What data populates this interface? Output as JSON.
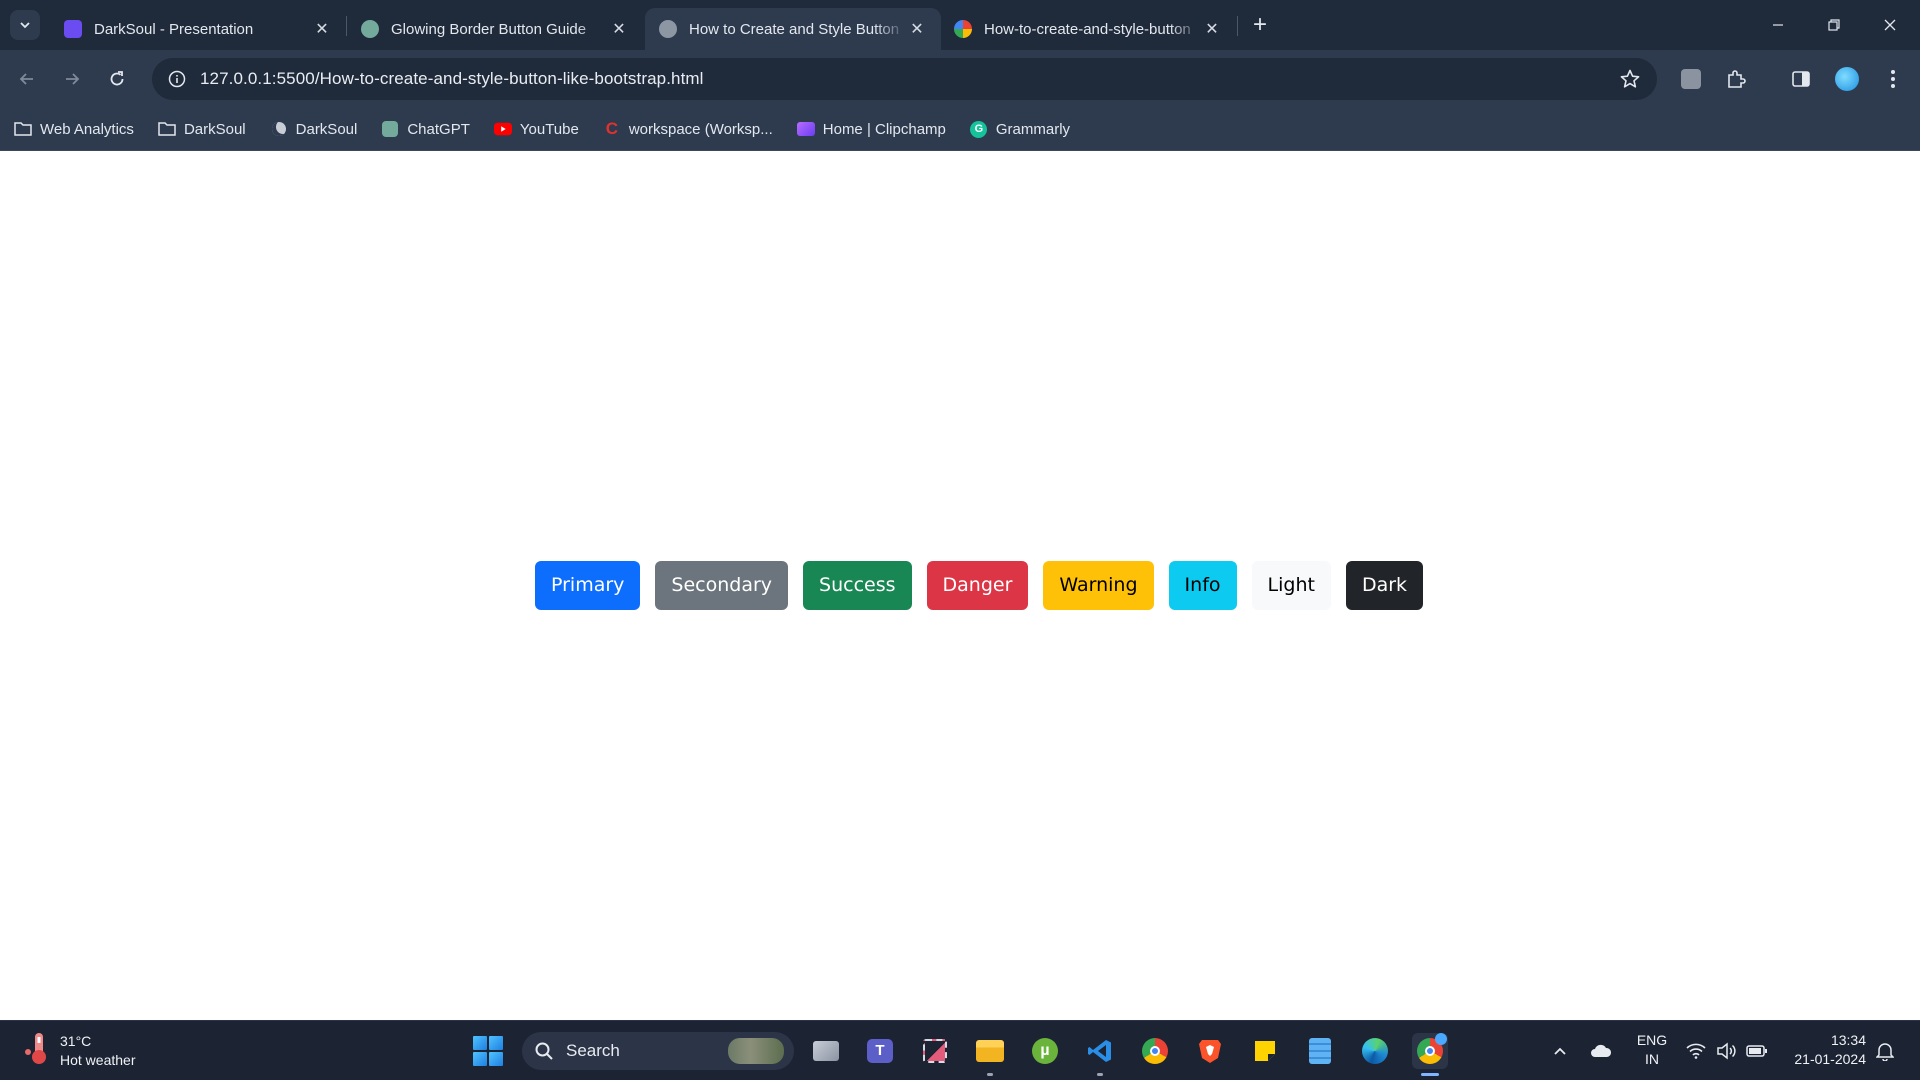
{
  "tabs": [
    {
      "title": "DarkSoul - Presentation",
      "active": false
    },
    {
      "title": "Glowing Border Button Guide",
      "active": false
    },
    {
      "title": "How to Create and Style Button",
      "active": true
    },
    {
      "title": "How-to-create-and-style-button",
      "active": false
    }
  ],
  "new_tab_label": "+",
  "address_bar": {
    "url": "127.0.0.1:5500/How-to-create-and-style-button-like-bootstrap.html"
  },
  "bookmarks": [
    {
      "label": "Web Analytics",
      "icon": "folder-icon"
    },
    {
      "label": "DarkSoul",
      "icon": "folder-icon"
    },
    {
      "label": "DarkSoul",
      "icon": "darksoul-favicon"
    },
    {
      "label": "ChatGPT",
      "icon": "chatgpt-favicon"
    },
    {
      "label": "YouTube",
      "icon": "youtube-favicon"
    },
    {
      "label": "workspace (Worksp...",
      "icon": "codepen-favicon"
    },
    {
      "label": "Home | Clipchamp",
      "icon": "clipchamp-favicon"
    },
    {
      "label": "Grammarly",
      "icon": "grammarly-favicon"
    }
  ],
  "page": {
    "buttons": [
      {
        "label": "Primary",
        "bg": "#0d6efd",
        "fg": "#ffffff"
      },
      {
        "label": "Secondary",
        "bg": "#6c757d",
        "fg": "#ffffff"
      },
      {
        "label": "Success",
        "bg": "#198754",
        "fg": "#ffffff"
      },
      {
        "label": "Danger",
        "bg": "#dc3545",
        "fg": "#ffffff"
      },
      {
        "label": "Warning",
        "bg": "#ffc107",
        "fg": "#000000"
      },
      {
        "label": "Info",
        "bg": "#0dcaf0",
        "fg": "#000000"
      },
      {
        "label": "Light",
        "bg": "#f8f9fa",
        "fg": "#000000"
      },
      {
        "label": "Dark",
        "bg": "#212529",
        "fg": "#ffffff"
      }
    ]
  },
  "taskbar": {
    "weather": {
      "temp": "31°C",
      "desc": "Hot weather"
    },
    "search_label": "Search",
    "language": {
      "line1": "ENG",
      "line2": "IN"
    },
    "clock": {
      "time": "13:34",
      "date": "21-01-2024"
    }
  },
  "colors": {
    "tabstrip": "#1f2a3a",
    "toolbar": "#2e3b4f",
    "taskbar": "#1c2333"
  }
}
